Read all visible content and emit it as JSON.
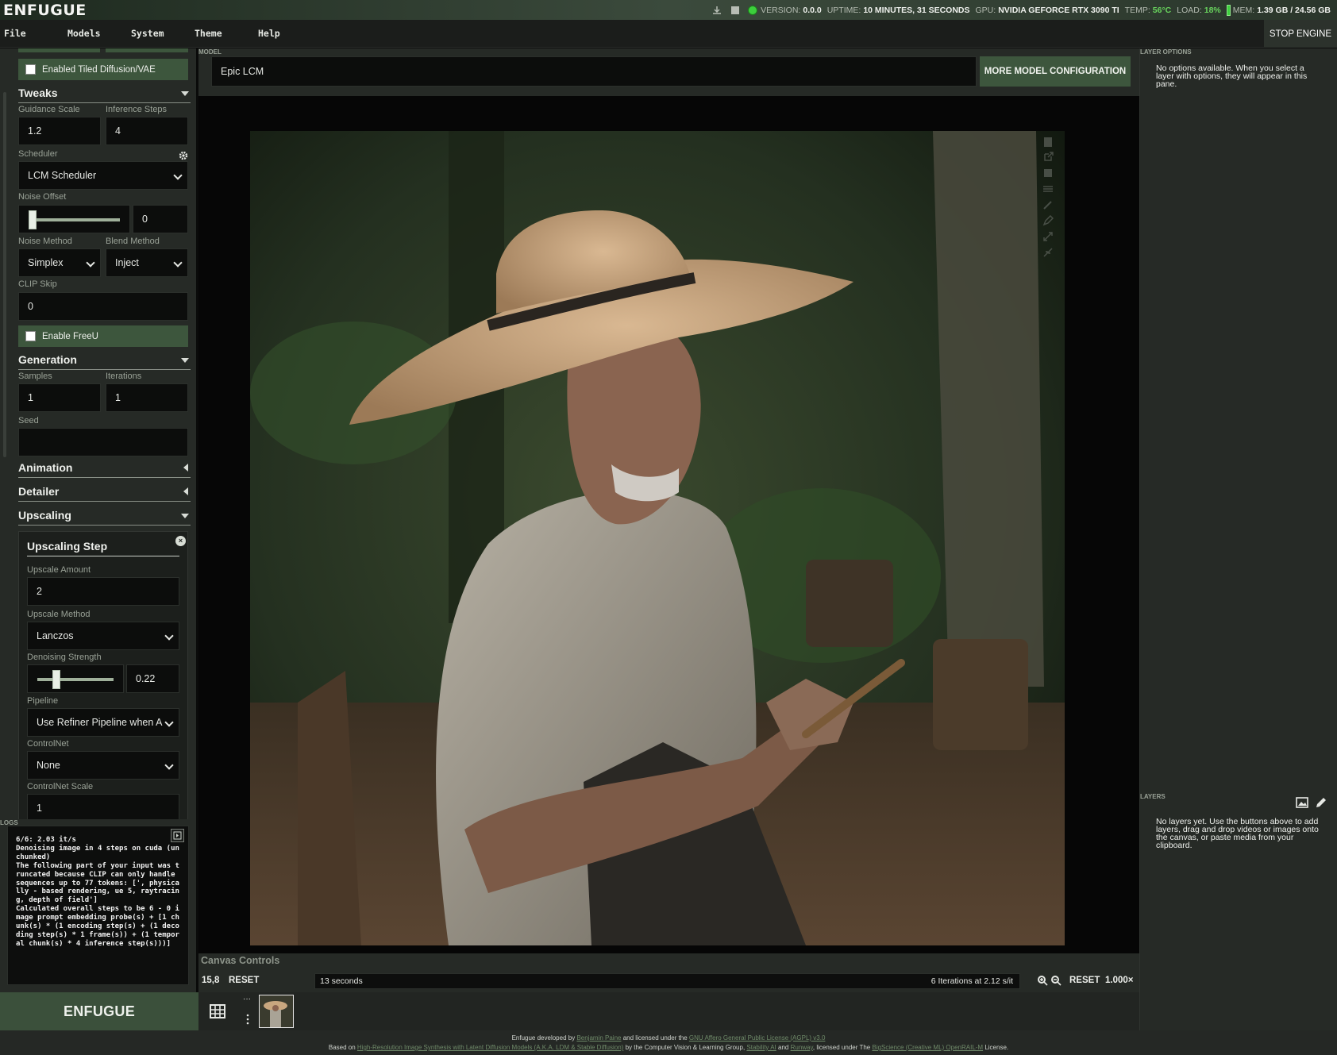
{
  "header": {
    "logo": "ENFUGUE",
    "status": {
      "version_label": "VERSION:",
      "version": "0.0.0",
      "uptime_label": "UPTIME:",
      "uptime": "10 MINUTES, 31 SECONDS",
      "gpu_label": "GPU:",
      "gpu": "NVIDIA GEFORCE RTX 3090 TI",
      "temp_label": "TEMP:",
      "temp": "56°C",
      "load_label": "LOAD:",
      "load": "18%",
      "mem_label": "MEM:",
      "mem": "1.39 GB / 24.56 GB"
    }
  },
  "menu": {
    "items": [
      "File",
      "Models",
      "System",
      "Theme",
      "Help"
    ],
    "stop_engine": "STOP ENGINE"
  },
  "sidebar": {
    "tiled_checkbox": "Enabled Tiled Diffusion/VAE",
    "tweaks": {
      "title": "Tweaks",
      "guidance_label": "Guidance Scale",
      "guidance_value": "1.2",
      "steps_label": "Inference Steps",
      "steps_value": "4",
      "scheduler_label": "Scheduler",
      "scheduler_value": "LCM Scheduler",
      "noise_offset_label": "Noise Offset",
      "noise_offset_value": "0",
      "noise_method_label": "Noise Method",
      "noise_method_value": "Simplex",
      "blend_method_label": "Blend Method",
      "blend_method_value": "Inject",
      "clip_skip_label": "CLIP Skip",
      "clip_skip_value": "0",
      "freeu_checkbox": "Enable FreeU"
    },
    "generation": {
      "title": "Generation",
      "samples_label": "Samples",
      "samples_value": "1",
      "iterations_label": "Iterations",
      "iterations_value": "1",
      "seed_label": "Seed",
      "seed_value": ""
    },
    "animation_title": "Animation",
    "detailer_title": "Detailer",
    "upscaling": {
      "title": "Upscaling",
      "step_title": "Upscaling Step",
      "amount_label": "Upscale Amount",
      "amount_value": "2",
      "method_label": "Upscale Method",
      "method_value": "Lanczos",
      "denoise_label": "Denoising Strength",
      "denoise_value": "0.22",
      "pipeline_label": "Pipeline",
      "pipeline_value": "Use Refiner Pipeline when A",
      "controlnet_label": "ControlNet",
      "controlnet_value": "None",
      "controlnet_scale_label": "ControlNet Scale",
      "controlnet_scale_value": "1"
    }
  },
  "logs": {
    "title": "LOGS",
    "text": "6/6: 2.03 it/s\nDenoising image in 4 steps on cuda (unchunked)\nThe following part of your input was truncated because CLIP can only handle sequences up to 77 tokens: [', physically - based rendering, ue 5, raytracing, depth of field']\nCalculated overall steps to be 6 - 0 image prompt embedding probe(s) + [1 chunk(s) * (1 encoding step(s) + (1 decoding step(s) * 1 frame(s)) + (1 temporal chunk(s) * 4 inference step(s)))]"
  },
  "model": {
    "label": "MODEL",
    "value": "Epic LCM",
    "more_button": "MORE MODEL CONFIGURATION"
  },
  "canvas_controls": {
    "title": "Canvas Controls",
    "coords": "15,8",
    "reset_left": "RESET",
    "elapsed": "13 seconds",
    "iterations": "6 Iterations at 2.12 s/it",
    "reset_right": "RESET",
    "zoom": "1.000×"
  },
  "bottom": {
    "logo": "ENFUGUE"
  },
  "right_panel": {
    "layer_options_label": "LAYER OPTIONS",
    "layer_options_text": "No options available. When you select a layer with options, they will appear in this pane.",
    "layers_label": "LAYERS",
    "layers_text": "No layers yet. Use the buttons above to add layers, drag and drop videos or images onto the canvas, or paste media from your clipboard."
  },
  "footer": {
    "l1a": "Enfugue developed by",
    "l1b": "Benjamin Paine",
    "l1c": "and licensed under the",
    "l1d": "GNU Affero General Public License (AGPL) v3.0",
    "l2a": "Based on",
    "l2b": "High-Resolution Image Synthesis with Latent Diffusion Models (A.K.A. LDM & Stable Diffusion)",
    "l2c": "by the Computer Vision & Learning Group,",
    "l2d": "Stability AI",
    "l2e": "and",
    "l2f": "Runway",
    "l2g": ", licensed under The",
    "l2h": "BigScience (Creative ML) OpenRAIL-M",
    "l2i": "License."
  }
}
